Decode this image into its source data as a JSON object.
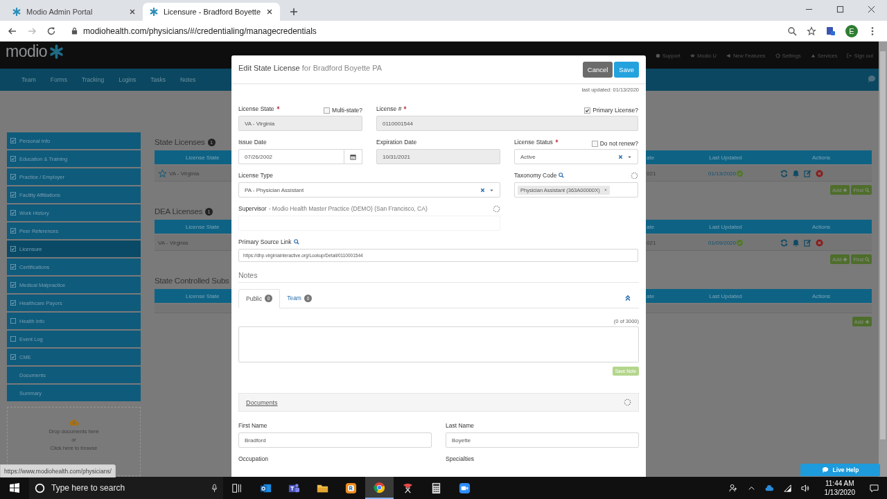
{
  "browser": {
    "tabs": [
      {
        "title": "Modio Admin Portal",
        "selected": false
      },
      {
        "title": "Licensure - Bradford Boyette",
        "selected": true
      }
    ],
    "url": "modiohealth.com/physicians/#/credentialing/managecredentials",
    "profile_initial": "E"
  },
  "app": {
    "logo": "modio",
    "header_links": [
      {
        "label": "Support",
        "kind": "help"
      },
      {
        "label": "Modio U",
        "kind": "cap"
      },
      {
        "label": "New Features",
        "kind": "megaphone"
      },
      {
        "label": "Settings",
        "kind": "gear"
      },
      {
        "label": "Services",
        "kind": "cloud"
      },
      {
        "label": "Sign out",
        "kind": "signout"
      }
    ],
    "nav": [
      "Team",
      "Forms",
      "Tracking",
      "Logins",
      "Tasks",
      "Notes"
    ]
  },
  "sidebar": {
    "items": [
      {
        "label": "Personal Info",
        "kind": "check",
        "checked": true,
        "selected": false
      },
      {
        "label": "Education & Training",
        "kind": "check",
        "checked": true,
        "selected": false
      },
      {
        "label": "Practice / Employer",
        "kind": "check",
        "checked": true,
        "selected": false
      },
      {
        "label": "Facility Affiliations",
        "kind": "check",
        "checked": true,
        "selected": false
      },
      {
        "label": "Work History",
        "kind": "check",
        "checked": true,
        "selected": false
      },
      {
        "label": "Peer References",
        "kind": "check",
        "checked": true,
        "selected": false
      },
      {
        "label": "Licensure",
        "kind": "check",
        "checked": true,
        "selected": true
      },
      {
        "label": "Certifications",
        "kind": "check",
        "checked": true,
        "selected": false
      },
      {
        "label": "Medical Malpractice",
        "kind": "check",
        "checked": true,
        "selected": false
      },
      {
        "label": "Healthcare Payors",
        "kind": "check",
        "checked": true,
        "selected": false
      },
      {
        "label": "Health Info",
        "kind": "check",
        "checked": false,
        "selected": false
      },
      {
        "label": "Event Log",
        "kind": "check",
        "checked": false,
        "selected": false
      },
      {
        "label": "CME",
        "kind": "check",
        "checked": true,
        "selected": false
      },
      {
        "label": "Documents",
        "kind": "plain",
        "selected": false
      },
      {
        "label": "Summary",
        "kind": "plain",
        "selected": false
      }
    ],
    "drop_zone": {
      "text": "Drop documents here",
      "separator": "or",
      "link": "Click here to browse"
    }
  },
  "sections": [
    {
      "title": "State Licenses",
      "count": "1",
      "columns": [
        "License State",
        "ate",
        "Last Updated",
        "Actions"
      ],
      "rows": [
        {
          "primary": true,
          "state": "VA - Virginia",
          "column_2": "021",
          "last_updated": "01/13/2020",
          "verified": true
        }
      ],
      "buttons": [
        {
          "label": "Add",
          "kind": "add"
        },
        {
          "label": "Find",
          "kind": "find"
        }
      ]
    },
    {
      "title": "DEA Licenses",
      "count": "1",
      "columns": [
        "License State",
        "ate",
        "Last Updated",
        "Actions"
      ],
      "rows": [
        {
          "primary": false,
          "state": "VA - Virginia",
          "column_2": "021",
          "last_updated": "01/09/2020",
          "verified": true
        }
      ],
      "buttons": [
        {
          "label": "Add",
          "kind": "add"
        },
        {
          "label": "Find",
          "kind": "find"
        }
      ]
    },
    {
      "title": "State Controlled Subs",
      "columns": [
        "License State",
        "ate",
        "Last Updated",
        "Actions"
      ],
      "buttons": [
        {
          "label": "Add",
          "kind": "add"
        }
      ]
    }
  ],
  "modal": {
    "title": "Edit State License",
    "subtitle": "for Bradford Boyette PA",
    "buttons": [
      {
        "label": "Cancel",
        "kind": "secondary"
      },
      {
        "label": "Save",
        "kind": "primary"
      }
    ],
    "last_updated": "last updated: 01/13/2020",
    "license_state": {
      "label": "License State",
      "required": true,
      "value": "VA - Virginia",
      "disabled": true,
      "option": {
        "label": "Multi-state?",
        "checked": false
      }
    },
    "license_number": {
      "label": "License #",
      "required": true,
      "value": "0110001544",
      "disabled": true,
      "option": {
        "label": "Primary License?",
        "checked": true
      }
    },
    "issue_date": {
      "label": "Issue Date",
      "value": "07/26/2002",
      "disabled": false
    },
    "expiration_date": {
      "label": "Expiration Date",
      "value": "10/31/2021",
      "disabled": true
    },
    "license_status": {
      "label": "License Status",
      "required": true,
      "value": "Active",
      "option": {
        "label": "Do not renew?",
        "checked": false
      }
    },
    "license_type": {
      "label": "License Type",
      "value": "PA - Physician Assistant"
    },
    "taxonomy_code": {
      "label": "Taxonomy Code",
      "loading": true,
      "tags": [
        "Physician Assistant (363A00000X)"
      ]
    },
    "supervisor": {
      "label": "Supervisor",
      "detail": "- Modio Health Master Practice (DEMO) (San Francisco, CA)",
      "loading": true
    },
    "primary_source_link": {
      "label": "Primary Source Link",
      "value": "https://dhp.virginiainteractive.org/Lookup/Detail/0110001544"
    },
    "notes": {
      "heading": "Notes",
      "tabs": [
        {
          "label": "Public",
          "count": "0",
          "selected": true
        },
        {
          "label": "Team",
          "count": "0",
          "selected": false
        }
      ],
      "char_count": "(0 of 3000)",
      "save_button": "Save Note"
    },
    "documents": {
      "title": "Documents",
      "loading": true
    },
    "first_name": {
      "label": "First Name",
      "value": "Bradford"
    },
    "last_name": {
      "label": "Last Name",
      "value": "Boyette"
    },
    "occupation_label": "Occupation",
    "specialties_label": "Specialties"
  },
  "status_url": "https://www.modiohealth.com/physicians/",
  "live_help": "Live Help",
  "taskbar": {
    "search_placeholder": "Type here to search",
    "apps": [
      {
        "kind": "taskview",
        "selected": false
      },
      {
        "kind": "mail",
        "selected": false
      },
      {
        "kind": "team",
        "selected": false
      },
      {
        "kind": "folder",
        "selected": false
      },
      {
        "kind": "rapp",
        "selected": false
      },
      {
        "kind": "browser",
        "selected": true
      },
      {
        "kind": "snip",
        "selected": false
      },
      {
        "kind": "calculator",
        "selected": false
      },
      {
        "kind": "camera",
        "selected": false
      }
    ],
    "time": "11:44 AM",
    "date": "1/13/2020"
  }
}
